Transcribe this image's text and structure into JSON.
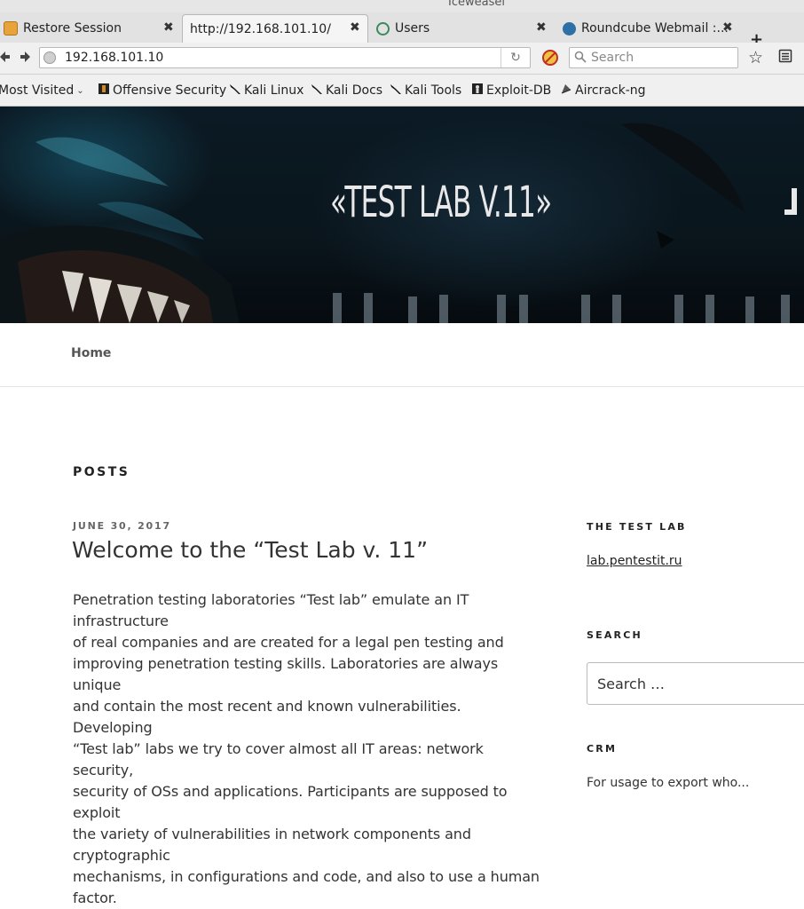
{
  "window": {
    "title": "Iceweasel"
  },
  "tabs": [
    {
      "label": "Restore Session",
      "icon": "restore-session-icon",
      "close": "✖"
    },
    {
      "label": "http://192.168.101.10/",
      "icon": "",
      "close": "✖",
      "active": true
    },
    {
      "label": "Users",
      "icon": "globe-icon",
      "close": "✖"
    },
    {
      "label": "Roundcube Webmail :...",
      "icon": "roundcube-icon",
      "close": "✖"
    }
  ],
  "new_tab": "+",
  "navbar": {
    "url": "192.168.101.10",
    "search_placeholder": "Search"
  },
  "bookmarks": [
    {
      "label": "Most Visited",
      "icon": "",
      "dropdown": true
    },
    {
      "label": "Offensive Security",
      "icon": "offsec-icon"
    },
    {
      "label": "Kali Linux",
      "icon": "kali-dragon-icon"
    },
    {
      "label": "Kali Docs",
      "icon": "kali-dragon-icon"
    },
    {
      "label": "Kali Tools",
      "icon": "kali-dragon-icon"
    },
    {
      "label": "Exploit-DB",
      "icon": "exploit-db-icon"
    },
    {
      "label": "Aircrack-ng",
      "icon": "aircrack-icon"
    }
  ],
  "hero": {
    "title": "«TEST LAB V.11»"
  },
  "site_nav": {
    "home": "Home"
  },
  "main": {
    "heading": "POSTS",
    "post": {
      "date": "JUNE 30, 2017",
      "title": "Welcome to the “Test Lab v. 11”",
      "lines": [
        "Penetration testing laboratories “Test lab” emulate an IT infrastructure",
        "of real companies and are created for a legal pen testing and",
        "improving penetration testing skills. Laboratories are always unique",
        "and contain the most recent and known vulnerabilities.  Developing",
        "“Test lab” labs we try to cover almost all IT areas: network security,",
        "security of OSs and applications. Participants are supposed to exploit",
        "the variety of vulnerabilities in network components and cryptographic",
        "mechanisms, in configurations and code, and also to use a human",
        "factor."
      ]
    }
  },
  "sidebar": {
    "testlab": {
      "title": "THE TEST LAB",
      "link": "lab.pentestit.ru"
    },
    "search": {
      "title": "SEARCH",
      "placeholder": "Search …"
    },
    "crm": {
      "title": "CRM",
      "text": "For usage to export who..."
    }
  }
}
